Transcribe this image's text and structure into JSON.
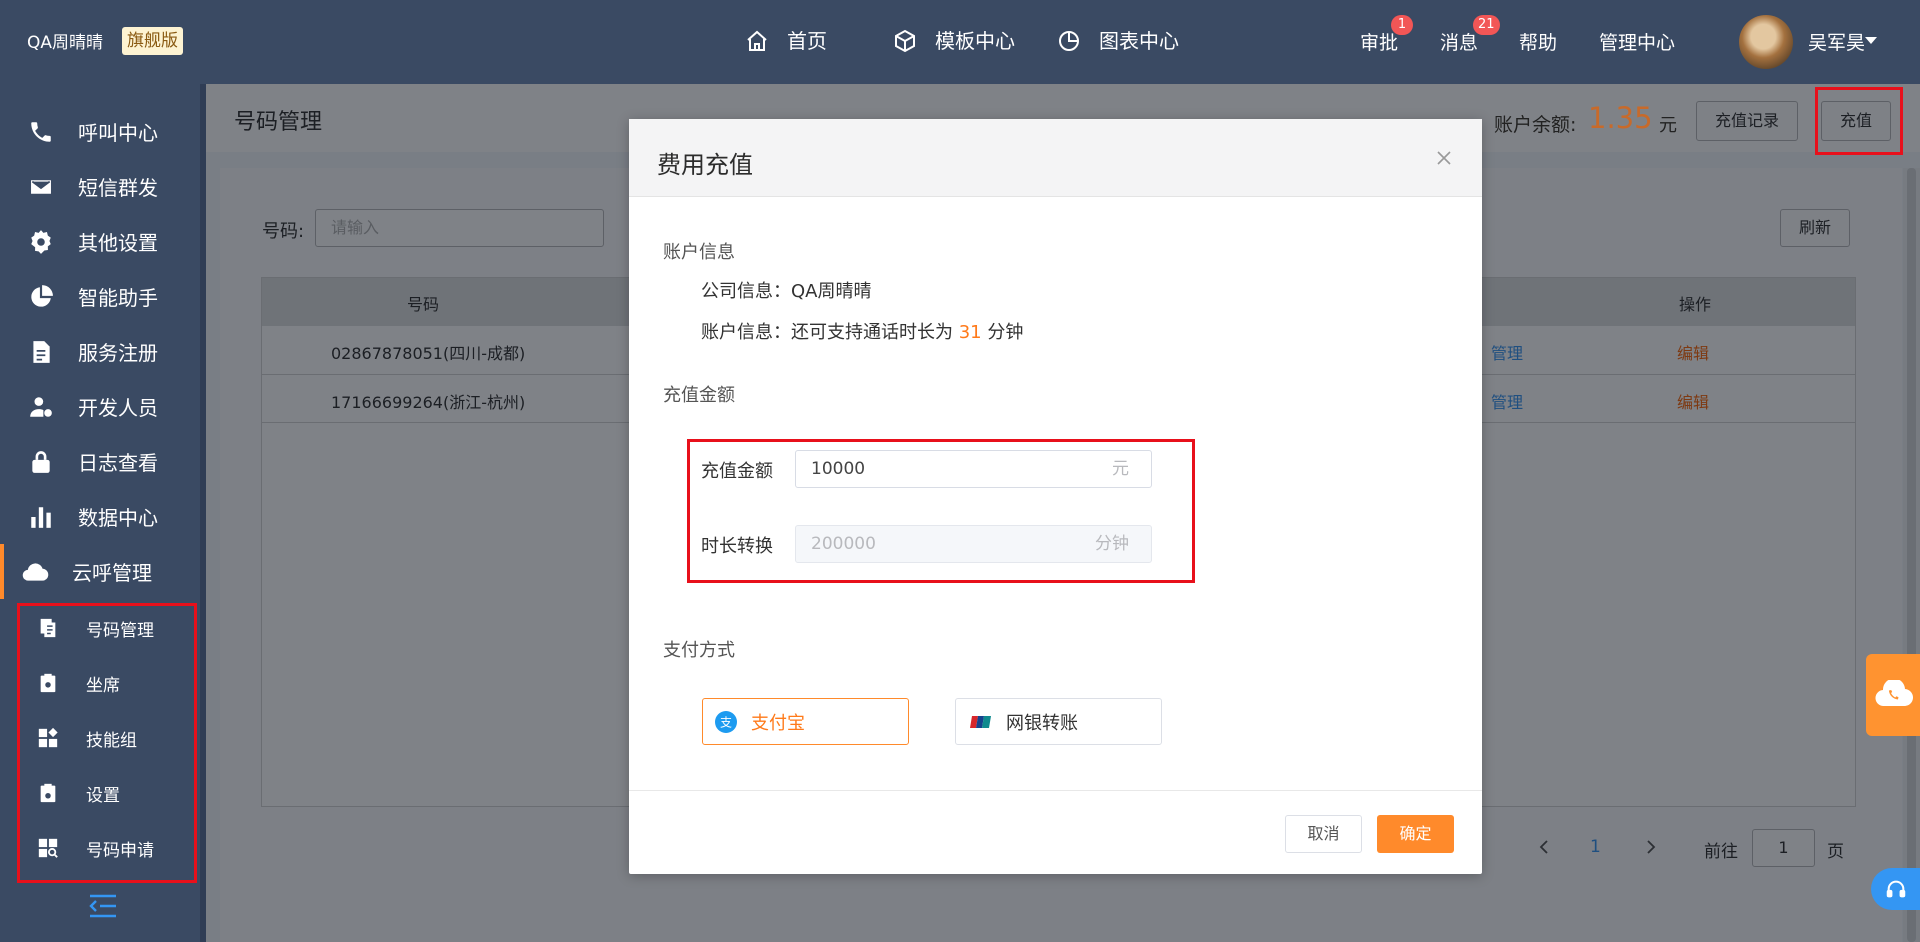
{
  "header": {
    "brand": "QA周晴晴",
    "brand_badge": "旗舰版",
    "nav": [
      {
        "label": "首页",
        "icon": "home-icon"
      },
      {
        "label": "模板中心",
        "icon": "cube-icon"
      },
      {
        "label": "图表中心",
        "icon": "pie-chart-icon"
      }
    ],
    "links": {
      "approve": "审批",
      "messages": "消息",
      "help": "帮助",
      "admin": "管理中心"
    },
    "badges": {
      "approve": "1",
      "messages": "21"
    },
    "user_name": "吴军昊"
  },
  "sidebar": {
    "items": [
      {
        "label": "呼叫中心",
        "icon": "phone-icon"
      },
      {
        "label": "短信群发",
        "icon": "mail-icon"
      },
      {
        "label": "其他设置",
        "icon": "gear-icon"
      },
      {
        "label": "智能助手",
        "icon": "pie-icon"
      },
      {
        "label": "服务注册",
        "icon": "document-icon"
      },
      {
        "label": "开发人员",
        "icon": "developer-icon"
      },
      {
        "label": "日志查看",
        "icon": "lock-icon"
      },
      {
        "label": "数据中心",
        "icon": "bar-chart-icon"
      },
      {
        "label": "云呼管理",
        "icon": "cloud-phone-icon"
      }
    ],
    "sub_items": [
      {
        "label": "号码管理",
        "icon": "number-list-icon"
      },
      {
        "label": "坐席",
        "icon": "seat-icon"
      },
      {
        "label": "技能组",
        "icon": "skill-group-icon"
      },
      {
        "label": "设置",
        "icon": "settings-icon"
      },
      {
        "label": "号码申请",
        "icon": "number-apply-icon"
      }
    ]
  },
  "main": {
    "page_title": "号码管理",
    "balance_label": "账户余额:",
    "balance_value": "1.35",
    "balance_unit": "元",
    "recharge_record_button": "充值记录",
    "recharge_button": "充值",
    "filter_label": "号码:",
    "filter_placeholder": "请输入",
    "refresh_button": "刷新",
    "table": {
      "headers": {
        "number": "号码",
        "action": "操作"
      },
      "rows": [
        {
          "number": "02867878051(四川-成都)",
          "manage": "管理",
          "edit": "编辑"
        },
        {
          "number": "17166699264(浙江-杭州)",
          "manage": "管理",
          "edit": "编辑"
        }
      ]
    },
    "pager": {
      "current": "1",
      "goto_label": "前往",
      "goto_value": "1",
      "page_unit": "页"
    }
  },
  "modal": {
    "title": "费用充值",
    "account_section": "账户信息",
    "company_label": "公司信息：",
    "company_value": "QA周晴晴",
    "account_label": "账户信息：",
    "account_prefix": "还可支持通话时长为",
    "account_minutes": "31",
    "account_suffix": "分钟",
    "amount_section": "充值金额",
    "amount_label": "充值金额",
    "amount_value": "10000",
    "amount_unit": "元",
    "duration_label": "时长转换",
    "duration_value": "200000",
    "duration_unit": "分钟",
    "payment_section": "支付方式",
    "pay_alipay": "支付宝",
    "pay_bank": "网银转账",
    "cancel": "取消",
    "confirm": "确定"
  },
  "colors": {
    "topbar": "#3a4a63",
    "accent": "#ff8a2b",
    "highlight_box": "#e8101b",
    "link_blue": "#3496f3"
  }
}
